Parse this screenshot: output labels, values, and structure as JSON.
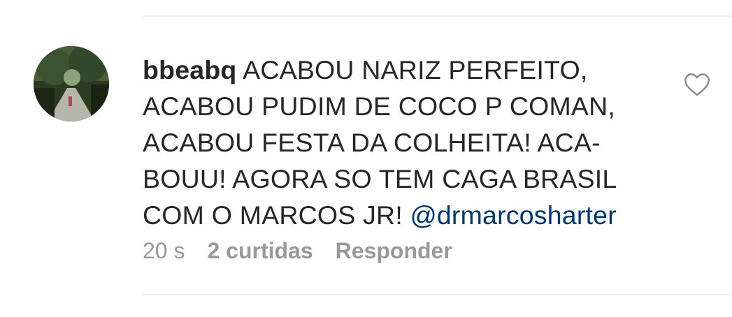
{
  "comment": {
    "username": "bbeabq",
    "text_line1": "ACABOU NARIZ PERFEITO,",
    "text_line2": "ACABOU PUDIM DE COCO P COMAN,",
    "text_line3": "ACABOU FESTA DA COLHEITA! ACA-",
    "text_line4": "BOUU! AGORA SO TEM CAGA BRASIL",
    "text_line5": "COM O MARCOS JR!",
    "mention": "@drmarcosharter"
  },
  "meta": {
    "time": "20 s",
    "likes": "2 curtidas",
    "reply": "Responder"
  },
  "icons": {
    "like": "heart-outline-icon",
    "avatar": "avatar-photo-forest-path"
  },
  "colors": {
    "text": "#262626",
    "mention": "#003569",
    "meta": "#999999"
  }
}
